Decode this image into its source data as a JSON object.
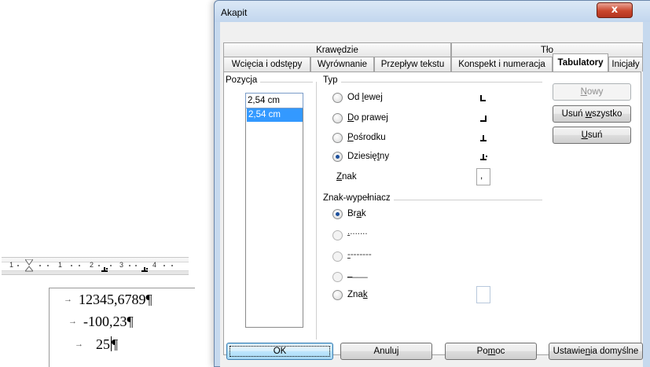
{
  "ruler": {
    "numbers": [
      "1",
      "1",
      "2",
      "3",
      "4"
    ]
  },
  "document": {
    "lines": [
      {
        "tab_mark": "→",
        "text": "12345,6789¶"
      },
      {
        "tab_mark": "→",
        "text": "-100,23¶"
      },
      {
        "tab_mark": "→",
        "text": "25",
        "pilcrow": "¶"
      }
    ]
  },
  "dialog": {
    "title": "Akapit",
    "close_label": "x",
    "tabs_top": [
      {
        "label": "Krawędzie"
      },
      {
        "label": "Tło"
      }
    ],
    "tabs_bottom": [
      {
        "label": "Wcięcia i odstępy"
      },
      {
        "label": "Wyrównanie"
      },
      {
        "label": "Przepływ tekstu"
      },
      {
        "label": "Konspekt i numeracja"
      },
      {
        "label": "Tabulatory"
      },
      {
        "label": "Inicjały"
      }
    ],
    "position": {
      "group_label": "Pozycja",
      "input_value": "2,54 cm",
      "list_items": [
        "2,54 cm"
      ]
    },
    "type": {
      "group_label": "Typ",
      "options": [
        {
          "pre": "Od ",
          "key": "l",
          "post": "ewej",
          "checked": false
        },
        {
          "pre": "",
          "key": "D",
          "post": "o prawej",
          "checked": false
        },
        {
          "pre": "",
          "key": "P",
          "post": "ośrodku",
          "checked": false
        },
        {
          "pre": "Dziesię",
          "key": "t",
          "post": "ny",
          "checked": true
        }
      ],
      "char_label_key": "Z",
      "char_label_rest": "nak",
      "char_value": ","
    },
    "fill": {
      "group_label": "Znak-wypełniacz",
      "options": [
        {
          "pre": "Br",
          "key": "a",
          "post": "k",
          "checked": true
        },
        {
          "pre": "",
          "key": ".",
          "post": ".......",
          "checked": false
        },
        {
          "pre": "",
          "key": "-",
          "post": "-------",
          "checked": false
        },
        {
          "pre": "",
          "key": "_",
          "post": "___",
          "checked": false
        },
        {
          "pre": "Zna",
          "key": "k",
          "post": "",
          "checked": false
        }
      ],
      "char_value": ""
    },
    "side_buttons": {
      "new": {
        "key": "N",
        "rest": "owy"
      },
      "delete_all": {
        "pre": "Usuń ",
        "key": "w",
        "rest": "szystko"
      },
      "delete": {
        "key": "U",
        "rest": "suń"
      }
    },
    "footer": {
      "ok": "OK",
      "cancel": "Anuluj",
      "help_pre": "Po",
      "help_key": "m",
      "help_post": "oc",
      "defaults_pre": "Ustawie",
      "defaults_key": "n",
      "defaults_post": "ia domyślne"
    }
  },
  "colors": {
    "selection": "#3399ff",
    "close": "#c9462d",
    "frame": "#c6d9ee"
  }
}
